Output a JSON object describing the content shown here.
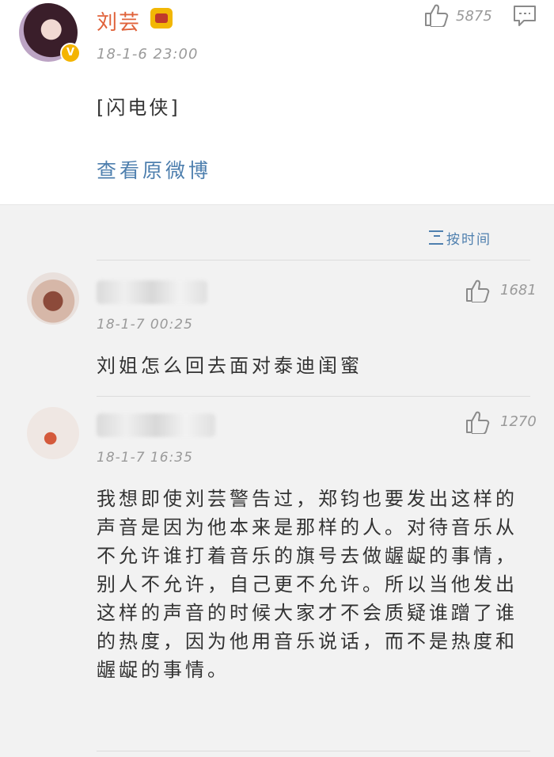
{
  "post": {
    "author": "刘芸",
    "crown_icon": "crown-icon",
    "verified_icon": "verified-badge-icon",
    "verified_mark": "V",
    "time": "18-1-6 23:00",
    "like_count": "5875",
    "content": "[闪电侠]",
    "view_original": "查看原微博"
  },
  "sort": {
    "label": "按时间",
    "icon": "sort-icon"
  },
  "comments": [
    {
      "time": "18-1-7 00:25",
      "like_count": "1681",
      "text": "刘姐怎么回去面对泰迪闺蜜"
    },
    {
      "time": "18-1-7 16:35",
      "like_count": "1270",
      "text": "我想即使刘芸警告过，郑钧也要发出这样的声音是因为他本来是那样的人。对待音乐从不允许谁打着音乐的旗号去做龌龊的事情，别人不允许，自己更不允许。所以当他发出这样的声音的时候大家才不会质疑谁蹭了谁的热度，因为他用音乐说话，而不是热度和龌龊的事情。"
    }
  ],
  "colors": {
    "name": "#e0623a",
    "link": "#4e7fae",
    "meta": "#9a9a9a",
    "text": "#333333",
    "background": "#f2f2f2"
  }
}
